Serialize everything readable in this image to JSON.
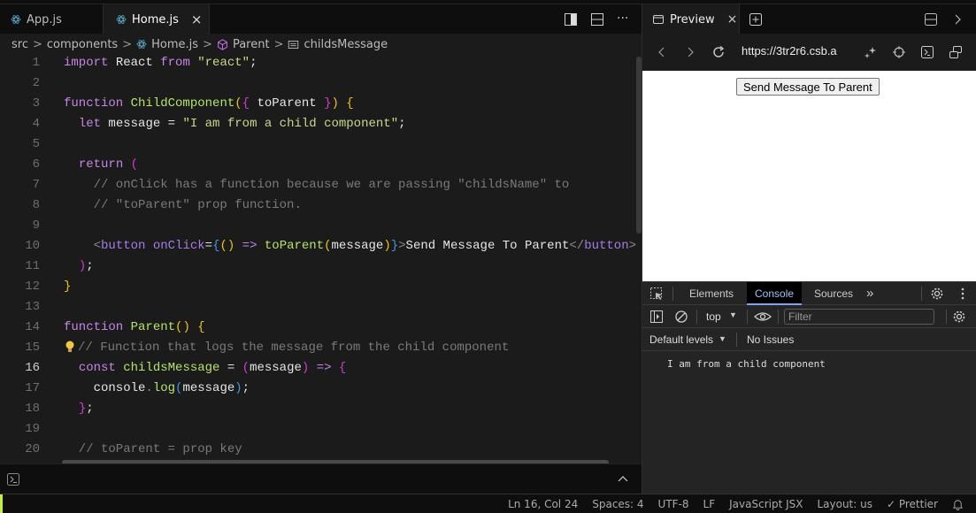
{
  "editor": {
    "tabs": [
      {
        "label": "App.js",
        "active": false
      },
      {
        "label": "Home.js",
        "active": true
      }
    ],
    "tab_close": "×",
    "breadcrumb": [
      "src",
      "components",
      "Home.js",
      "Parent",
      "childsMessage"
    ],
    "breadcrumb_sep": ">",
    "current_line": 16,
    "code_lines": [
      {
        "n": "1"
      },
      {
        "n": "2"
      },
      {
        "n": "3"
      },
      {
        "n": "4"
      },
      {
        "n": "5"
      },
      {
        "n": "6"
      },
      {
        "n": "7"
      },
      {
        "n": "8"
      },
      {
        "n": "9"
      },
      {
        "n": "10"
      },
      {
        "n": "11"
      },
      {
        "n": "12"
      },
      {
        "n": "13"
      },
      {
        "n": "14"
      },
      {
        "n": "15"
      },
      {
        "n": "16"
      },
      {
        "n": "17"
      },
      {
        "n": "18"
      },
      {
        "n": "19"
      },
      {
        "n": "20"
      }
    ],
    "code": {
      "l1": [
        "import",
        " React ",
        "from",
        " ",
        "\"react\"",
        ";"
      ],
      "l3": [
        "function",
        " ",
        "ChildComponent",
        "(",
        "{",
        " toParent ",
        "}",
        ")",
        " ",
        "{"
      ],
      "l4": [
        "  ",
        "let",
        " message = ",
        "\"I am from a child component\"",
        ";"
      ],
      "l6": [
        "  ",
        "return",
        " ",
        "("
      ],
      "l7": "    // onClick has a function because we are passing \"childsName\" to",
      "l8": "    // \"toParent\" prop function.",
      "l10": [
        "    ",
        "<",
        "button",
        " ",
        "onClick",
        "=",
        "{",
        "()",
        " => ",
        "toParent",
        "(",
        "message",
        ")",
        "}",
        ">",
        "Send Message To Parent",
        "</",
        "button",
        ">"
      ],
      "l11": [
        "  ",
        ")",
        ";"
      ],
      "l12": [
        "}"
      ],
      "l14": [
        "function",
        " ",
        "Parent",
        "()",
        " ",
        "{"
      ],
      "l15": "// Function that logs the message from the child component",
      "l16": [
        "  ",
        "const",
        " ",
        "childsMessage",
        " = ",
        "(",
        "message",
        ")",
        " => ",
        "{"
      ],
      "l17": [
        "    console",
        ".",
        "log",
        "(",
        "message",
        ")",
        ";"
      ],
      "l18": [
        "  ",
        "}",
        ";"
      ],
      "l20": "  // toParent = prop key"
    }
  },
  "preview": {
    "tab_label": "Preview",
    "tab_close": "×",
    "url": "https://3tr2r6.csb.a",
    "page_button_label": "Send Message To Parent"
  },
  "devtools": {
    "tabs": [
      "Elements",
      "Console",
      "Sources"
    ],
    "active_tab": "Console",
    "more": "»",
    "context": "top",
    "filter_placeholder": "Filter",
    "levels": "Default levels",
    "issues": "No Issues",
    "console_output": [
      "I am from a child component"
    ]
  },
  "status": {
    "position": "Ln 16, Col 24",
    "spaces": "Spaces: 4",
    "encoding": "UTF-8",
    "eol": "LF",
    "language": "JavaScript JSX",
    "layout": "Layout: us",
    "prettier": "✓ Prettier",
    "accent_color": "#c5f03c"
  }
}
